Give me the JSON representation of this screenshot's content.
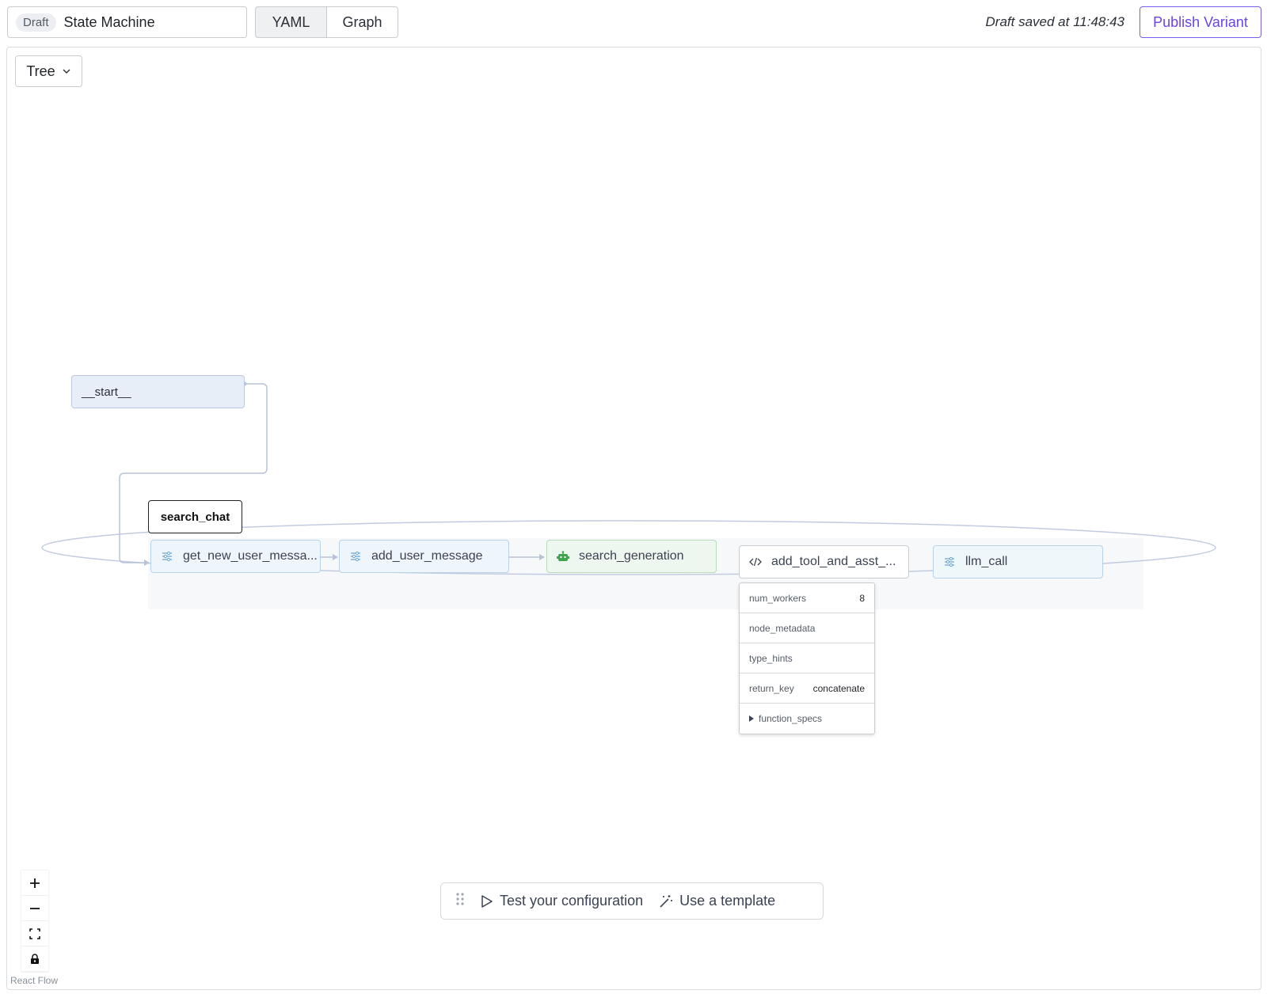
{
  "header": {
    "draft_badge": "Draft",
    "title": "State Machine",
    "view_tabs": [
      {
        "label": "YAML",
        "active": false
      },
      {
        "label": "Graph",
        "active": true
      }
    ],
    "saved_status": "Draft saved at 11:48:43",
    "publish_label": "Publish Variant"
  },
  "canvas": {
    "layout_select": "Tree",
    "start_node": "__start__",
    "group_label": "search_chat",
    "nodes": [
      {
        "label": "get_new_user_messa...",
        "icon": "sliders-icon"
      },
      {
        "label": "add_user_message",
        "icon": "sliders-icon"
      },
      {
        "label": "search_generation",
        "icon": "robot-icon"
      },
      {
        "label": "add_tool_and_asst_...",
        "icon": "code-icon"
      },
      {
        "label": "llm_call",
        "icon": "sliders-icon"
      }
    ],
    "popover": {
      "rows": [
        {
          "key": "num_workers",
          "value": "8"
        },
        {
          "key": "node_metadata",
          "value": ""
        },
        {
          "key": "type_hints",
          "value": ""
        },
        {
          "key": "return_key",
          "value": "concatenate"
        },
        {
          "key": "function_specs",
          "value": ""
        }
      ]
    },
    "attribution": "React Flow"
  },
  "bottom_bar": {
    "test_label": "Test your configuration",
    "template_label": "Use a template"
  },
  "colors": {
    "accent": "#6a44e8",
    "edge": "#b9c3d6"
  }
}
